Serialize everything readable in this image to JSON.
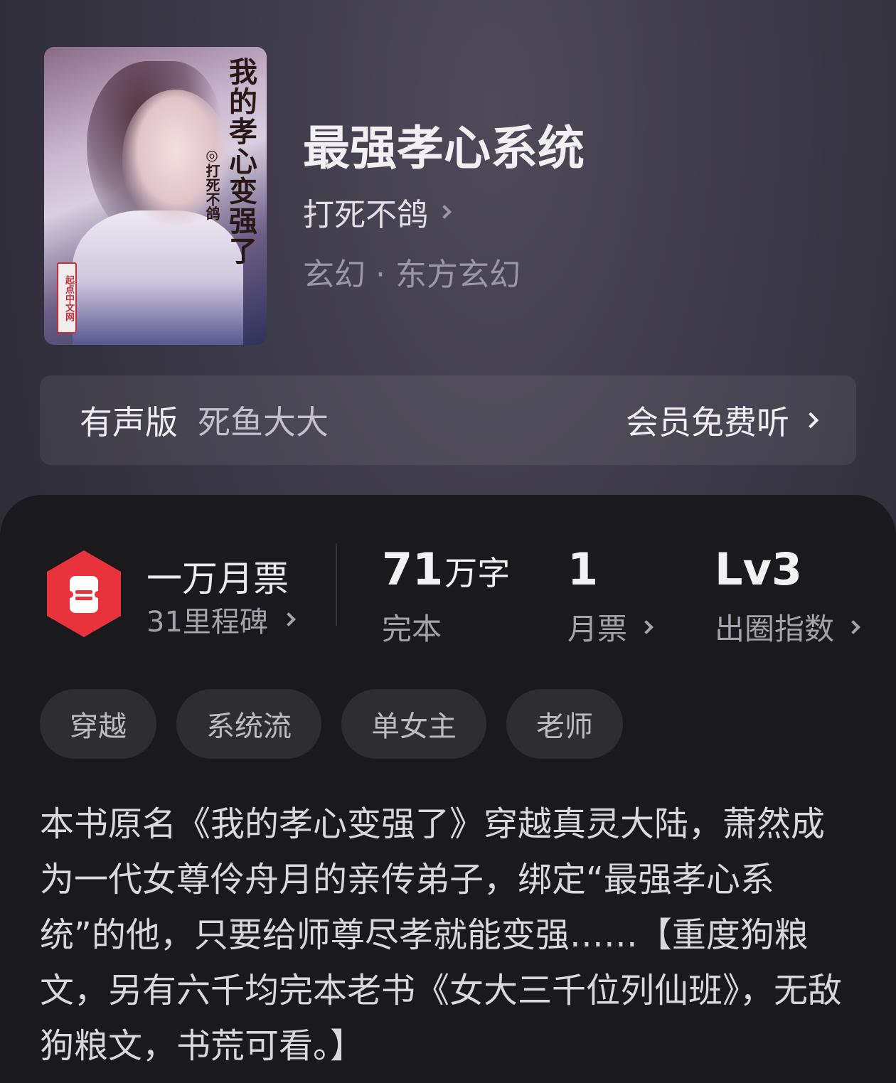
{
  "header": {
    "cover": {
      "title_text": "我的孝心变强了",
      "author_text": "◎打死不鸽",
      "publisher_text": "起点中文网"
    },
    "title": "最强孝心系统",
    "author": "打死不鸽",
    "genre": "玄幻 · 东方玄幻"
  },
  "audio": {
    "label": "有声版",
    "narrator": "死鱼大大",
    "action": "会员免费听"
  },
  "stats": {
    "ticket_badge_color": "#e8333c",
    "ticket_title": "一万月票",
    "ticket_sub": "31里程碑",
    "words_value": "71",
    "words_unit": "万字",
    "words_label": "完本",
    "monthly_value": "1",
    "monthly_label": "月票",
    "level_value": "Lv3",
    "level_label": "出圈指数"
  },
  "tags": [
    "穿越",
    "系统流",
    "单女主",
    "老师"
  ],
  "description": "本书原名《我的孝心变强了》穿越真灵大陆，萧然成为一代女尊伶舟月的亲传弟子，绑定“最强孝心系统”的他，只要给师尊尽孝就能变强……【重度狗粮文，另有六千均完本老书《女大三千位列仙班》，无敌狗粮文，书荒可看。】"
}
